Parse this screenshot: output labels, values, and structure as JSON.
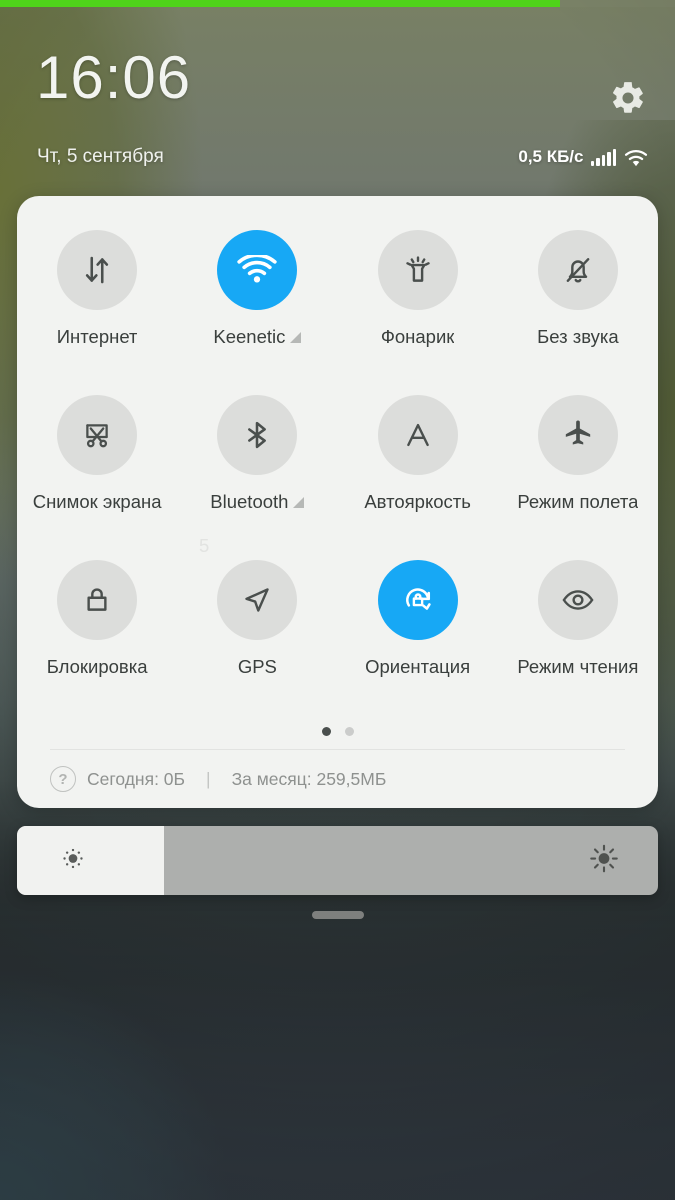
{
  "statusbar": {
    "clock": "16:06",
    "date": "Чт, 5 сентября",
    "network_speed": "0,5 КБ/с",
    "gear_icon": "gear-icon",
    "signal_icon": "signal-bars-icon",
    "wifi_icon": "wifi-icon",
    "progress_percent": 83,
    "progress_color": "#4fd31a"
  },
  "quick_settings": {
    "accent_color": "#17a8f5",
    "tiles": [
      {
        "label": "Интернет",
        "icon": "data-transfer-icon",
        "active": false,
        "expandable": false
      },
      {
        "label": "Keenetic",
        "icon": "wifi-icon",
        "active": true,
        "expandable": true
      },
      {
        "label": "Фонарик",
        "icon": "flashlight-icon",
        "active": false,
        "expandable": false
      },
      {
        "label": "Без звука",
        "icon": "bell-off-icon",
        "active": false,
        "expandable": false
      },
      {
        "label": "Снимок экрана",
        "icon": "screenshot-icon",
        "active": false,
        "expandable": false
      },
      {
        "label": "Bluetooth",
        "icon": "bluetooth-icon",
        "active": false,
        "expandable": true
      },
      {
        "label": "Автояркость",
        "icon": "auto-brightness-icon",
        "active": false,
        "expandable": false
      },
      {
        "label": "Режим полета",
        "icon": "airplane-icon",
        "active": false,
        "expandable": false
      },
      {
        "label": "Блокировка",
        "icon": "lock-icon",
        "active": false,
        "expandable": false
      },
      {
        "label": "GPS",
        "icon": "location-arrow-icon",
        "active": false,
        "expandable": false
      },
      {
        "label": "Ориентация",
        "icon": "rotation-lock-icon",
        "active": true,
        "expandable": false
      },
      {
        "label": "Режим чтения",
        "icon": "eye-icon",
        "active": false,
        "expandable": false
      }
    ],
    "ghost_char": "5",
    "pages": {
      "count": 2,
      "active": 1
    },
    "data_usage": {
      "help_icon": "question-mark-icon",
      "today": "Сегодня: 0Б",
      "separator": "|",
      "month": "За месяц: 259,5МБ"
    }
  },
  "brightness": {
    "level_percent": 23,
    "low_icon": "brightness-low-icon",
    "high_icon": "brightness-high-icon"
  },
  "home_handle": "drag-handle"
}
